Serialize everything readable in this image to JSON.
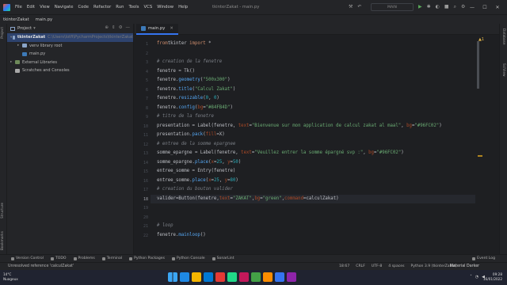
{
  "titlebar": {
    "menu": [
      "File",
      "Edit",
      "View",
      "Navigate",
      "Code",
      "Refactor",
      "Run",
      "Tools",
      "VCS",
      "Window",
      "Help"
    ],
    "title": "tkinterZakat - main.py",
    "run_config": "MAIN",
    "win_buttons": [
      "—",
      "☐",
      "✕"
    ]
  },
  "navbar": {
    "project": "tkinterZakat",
    "file": "main.py"
  },
  "project_panel": {
    "title": "Project",
    "tree": [
      {
        "label": "tkinterZakat",
        "path": "C:\\Users\\lotfi\\PycharmProjects\\tkinterZakat",
        "level": 0,
        "type": "folder",
        "expanded": true
      },
      {
        "label": "venv  library root",
        "level": 1,
        "type": "folder",
        "expanded": false
      },
      {
        "label": "main.py",
        "level": 1,
        "type": "pyfile"
      },
      {
        "label": "External Libraries",
        "level": 0,
        "type": "lib",
        "expanded": false
      },
      {
        "label": "Scratches and Consoles",
        "level": 0,
        "type": "scratch"
      }
    ]
  },
  "tab": {
    "label": "main.py"
  },
  "editor": {
    "current_line": 18,
    "lines": [
      {
        "n": "1",
        "segs": [
          [
            "kw",
            "from"
          ],
          [
            "",
            "tkinter "
          ],
          [
            "kw",
            "import"
          ],
          [
            "",
            " *"
          ]
        ]
      },
      {
        "n": "2",
        "segs": []
      },
      {
        "n": "3",
        "segs": [
          [
            "cm",
            "# creation de la fenetre"
          ]
        ]
      },
      {
        "n": "4",
        "segs": [
          [
            "",
            "fenetre = Tk()"
          ]
        ]
      },
      {
        "n": "5",
        "segs": [
          [
            "",
            "fenetre."
          ],
          [
            "nb",
            "geometry"
          ],
          [
            "",
            "("
          ],
          [
            "st",
            "\"500x300\""
          ],
          [
            "",
            ")"
          ]
        ]
      },
      {
        "n": "6",
        "segs": [
          [
            "",
            "fenetre."
          ],
          [
            "nb",
            "title"
          ],
          [
            "",
            "("
          ],
          [
            "st",
            "\"Calcul Zakat\""
          ],
          [
            "",
            ")"
          ]
        ]
      },
      {
        "n": "7",
        "segs": [
          [
            "",
            "fenetre."
          ],
          [
            "nb",
            "resizable"
          ],
          [
            "",
            "("
          ],
          [
            "num",
            "0"
          ],
          [
            "",
            ", "
          ],
          [
            "num",
            "0"
          ],
          [
            "",
            ")"
          ]
        ]
      },
      {
        "n": "8",
        "segs": [
          [
            "",
            "fenetre."
          ],
          [
            "nb",
            "config"
          ],
          [
            "",
            "("
          ],
          [
            "pm",
            "bg"
          ],
          [
            "",
            "="
          ],
          [
            "st",
            "\"#84FB4D\""
          ],
          [
            "",
            ")"
          ]
        ]
      },
      {
        "n": "9",
        "segs": [
          [
            "cm",
            "# titre de la fenetre"
          ]
        ]
      },
      {
        "n": "10",
        "segs": [
          [
            "",
            "presentation = Label(fenetre, "
          ],
          [
            "pm",
            "text"
          ],
          [
            "",
            "="
          ],
          [
            "st",
            "\"Bienvenue sur mon application de calcul zakat al maal\""
          ],
          [
            "",
            ", "
          ],
          [
            "pm",
            "bg"
          ],
          [
            "",
            "="
          ],
          [
            "st",
            "\"#96FC02\""
          ],
          [
            "",
            ")"
          ]
        ]
      },
      {
        "n": "11",
        "segs": [
          [
            "",
            "presentation."
          ],
          [
            "nb",
            "pack"
          ],
          [
            "",
            "("
          ],
          [
            "pm",
            "fill"
          ],
          [
            "",
            "=X)"
          ]
        ]
      },
      {
        "n": "12",
        "segs": [
          [
            "cm",
            "# entree de la somme epargnee"
          ]
        ]
      },
      {
        "n": "13",
        "segs": [
          [
            "",
            "somme_epargne = Label(fenetre, "
          ],
          [
            "pm",
            "text"
          ],
          [
            "",
            "="
          ],
          [
            "st",
            "\"Veuillez entrer la somme épargné svp :\""
          ],
          [
            "",
            ", "
          ],
          [
            "pm",
            "bg"
          ],
          [
            "",
            "="
          ],
          [
            "st",
            "\"#96FC02\""
          ],
          [
            "",
            ")"
          ]
        ]
      },
      {
        "n": "14",
        "segs": [
          [
            "",
            "somme_epargne."
          ],
          [
            "nb",
            "place"
          ],
          [
            "",
            "("
          ],
          [
            "pm",
            "x"
          ],
          [
            "",
            "="
          ],
          [
            "num",
            "25"
          ],
          [
            "",
            ", "
          ],
          [
            "pm",
            "y"
          ],
          [
            "",
            "="
          ],
          [
            "num",
            "50"
          ],
          [
            "",
            ")"
          ]
        ]
      },
      {
        "n": "15",
        "segs": [
          [
            "",
            "entree_somme = Entry(fenetre)"
          ]
        ]
      },
      {
        "n": "16",
        "segs": [
          [
            "",
            "entree_somme."
          ],
          [
            "nb",
            "place"
          ],
          [
            "",
            "("
          ],
          [
            "pm",
            "x"
          ],
          [
            "",
            "="
          ],
          [
            "num",
            "25"
          ],
          [
            "",
            ", "
          ],
          [
            "pm",
            "y"
          ],
          [
            "",
            "="
          ],
          [
            "num",
            "80"
          ],
          [
            "",
            ")"
          ]
        ]
      },
      {
        "n": "17",
        "segs": [
          [
            "cm",
            "# creation du bouton valider"
          ]
        ]
      },
      {
        "n": "18",
        "segs": [
          [
            "",
            "valider=Button(fenetre,"
          ],
          [
            "pm",
            "text"
          ],
          [
            "",
            "="
          ],
          [
            "st",
            "\"ZAKAT\""
          ],
          [
            "",
            ","
          ],
          [
            "pm",
            "bg"
          ],
          [
            "",
            "="
          ],
          [
            "st",
            "\"green\""
          ],
          [
            "",
            ","
          ],
          [
            "pm",
            "command"
          ],
          [
            "",
            "=calculZakat)"
          ]
        ]
      },
      {
        "n": "19",
        "segs": []
      },
      {
        "n": "20",
        "segs": []
      },
      {
        "n": "21",
        "segs": [
          [
            "cm",
            "# loop"
          ]
        ]
      },
      {
        "n": "22",
        "segs": [
          [
            "",
            "fenetre."
          ],
          [
            "nb",
            "mainloop"
          ],
          [
            "",
            "()"
          ]
        ]
      }
    ]
  },
  "tool_windows": [
    "Version Control",
    "TODO",
    "Problems",
    "Terminal",
    "Python Packages",
    "Python Console",
    "SonarLint"
  ],
  "event_log": "Event Log",
  "status": {
    "message": "Unresolved reference 'calculZakat'",
    "position": "18:67",
    "line_sep": "CRLF",
    "encoding": "UTF-8",
    "indent": "4 spaces",
    "interpreter": "Python 3.9 (tkinterZakat)",
    "theme": "Material Darker"
  },
  "taskbar": {
    "weather_temp": "14°C",
    "weather_desc": "Nuageux",
    "time": "09:28",
    "date": "16/01/2022",
    "app_colors": [
      "#1e88e5",
      "#f4b400",
      "#0078d4",
      "#e53935",
      "#21d789",
      "#c2185b",
      "#43a047",
      "#fb8c00",
      "#3574f0",
      "#8e24aa"
    ]
  },
  "colors": {
    "accent": "#3574f0",
    "background": "#1e1f22"
  }
}
